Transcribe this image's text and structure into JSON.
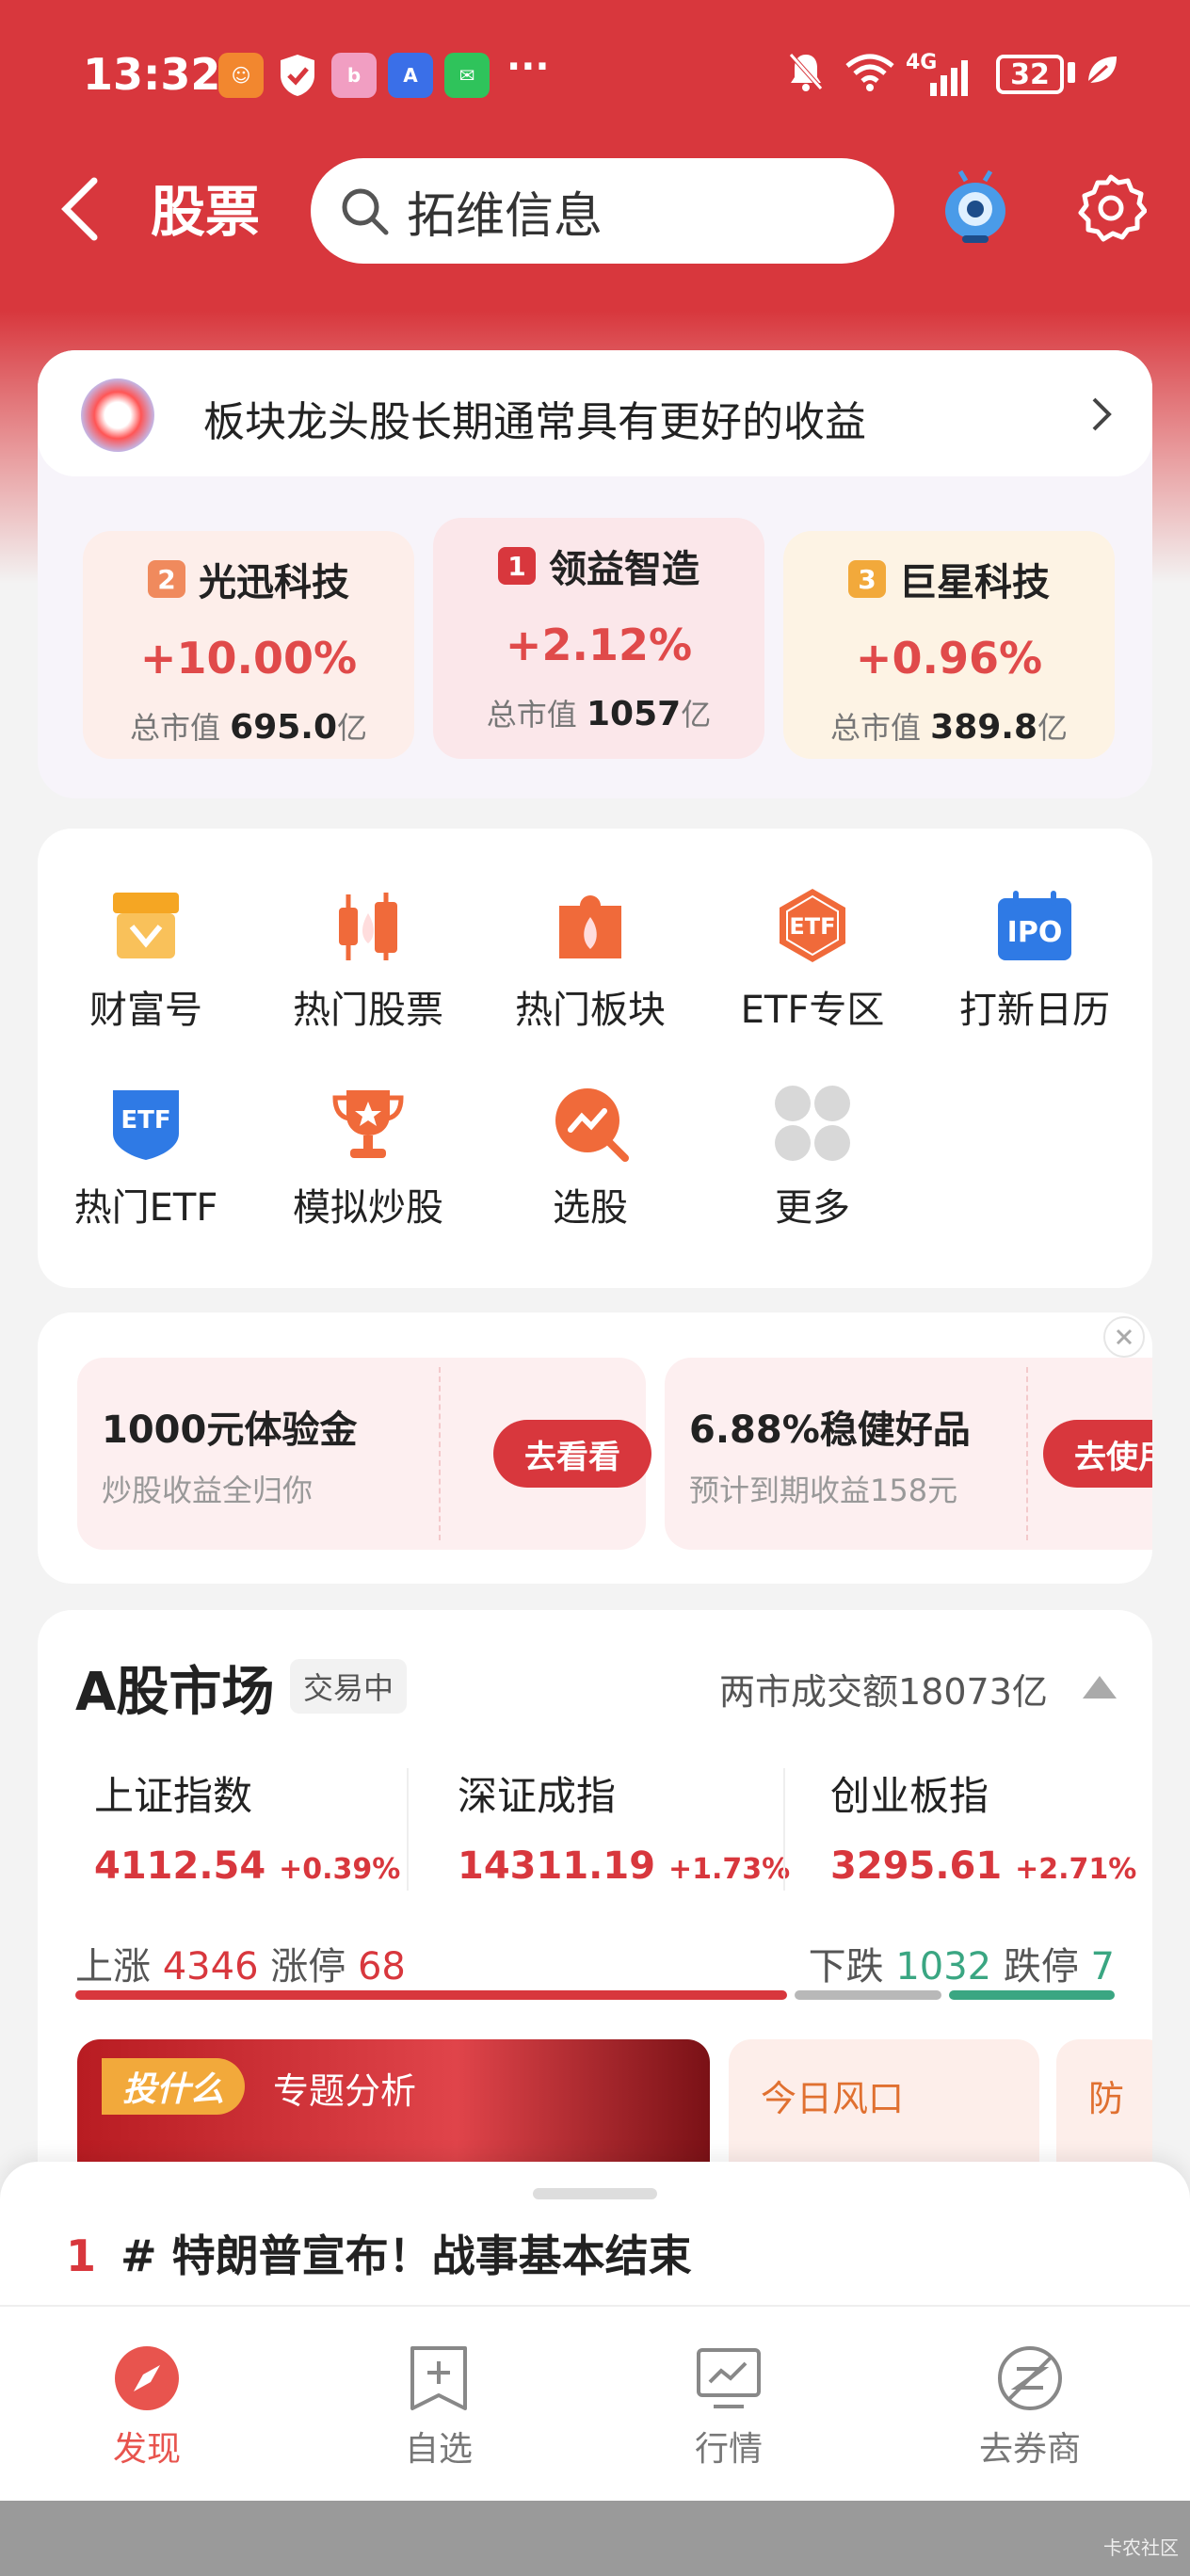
{
  "status_bar": {
    "time": "13:32",
    "more": "···",
    "network": "4G",
    "battery": "32"
  },
  "header": {
    "title": "股票",
    "search_placeholder": "拓维信息"
  },
  "banner": {
    "headline": "板块龙头股长期通常具有更好的收益",
    "stocks": [
      {
        "rank": "2",
        "name": "光迅科技",
        "change": "+10.00%",
        "mcap_label": "总市值",
        "mcap_value": "695.0",
        "mcap_unit": "亿"
      },
      {
        "rank": "1",
        "name": "领益智造",
        "change": "+2.12%",
        "mcap_label": "总市值",
        "mcap_value": "1057",
        "mcap_unit": "亿"
      },
      {
        "rank": "3",
        "name": "巨星科技",
        "change": "+0.96%",
        "mcap_label": "总市值",
        "mcap_value": "389.8",
        "mcap_unit": "亿"
      }
    ]
  },
  "shortcuts": [
    {
      "label": "财富号",
      "icon": "store-icon"
    },
    {
      "label": "热门股票",
      "icon": "candlestick-fire-icon"
    },
    {
      "label": "热门板块",
      "icon": "puzzle-fire-icon"
    },
    {
      "label": "ETF专区",
      "icon": "etf-badge-icon",
      "icon_text": "ETF"
    },
    {
      "label": "打新日历",
      "icon": "ipo-calendar-icon",
      "icon_text": "IPO"
    },
    {
      "label": "热门ETF",
      "icon": "etf-shield-icon",
      "icon_text": "ETF"
    },
    {
      "label": "模拟炒股",
      "icon": "trophy-icon"
    },
    {
      "label": "选股",
      "icon": "stock-picker-icon"
    },
    {
      "label": "更多",
      "icon": "more-grid-icon"
    }
  ],
  "promos": [
    {
      "title": "1000元体验金",
      "subtitle": "炒股收益全归你",
      "button": "去看看"
    },
    {
      "title": "6.88%稳健好品",
      "subtitle": "预计到期收益158元",
      "button": "去使用"
    }
  ],
  "market": {
    "title": "A股市场",
    "status": "交易中",
    "turnover": "两市成交额18073亿",
    "indices": [
      {
        "name": "上证指数",
        "value": "4112.54",
        "change": "+0.39%"
      },
      {
        "name": "深证成指",
        "value": "14311.19",
        "change": "+1.73%"
      },
      {
        "name": "创业板指",
        "value": "3295.61",
        "change": "+2.71%"
      }
    ],
    "up_label": "上涨",
    "up_count": "4346",
    "limit_up_label": "涨停",
    "limit_up_count": "68",
    "down_label": "下跌",
    "down_count": "1032",
    "limit_down_label": "跌停",
    "limit_down_count": "7",
    "cards": [
      {
        "tag": "投什么",
        "title": "专题分析"
      },
      {
        "title": "今日风口"
      },
      {
        "title": "防"
      }
    ]
  },
  "news": {
    "rank": "1",
    "text": "# 特朗普宣布！战事基本结束"
  },
  "tabs": [
    {
      "label": "发现",
      "icon": "compass-icon",
      "active": true
    },
    {
      "label": "自选",
      "icon": "bookmark-add-icon"
    },
    {
      "label": "行情",
      "icon": "chart-monitor-icon"
    },
    {
      "label": "去券商",
      "icon": "broker-icon"
    }
  ],
  "watermark": "卡农社区",
  "colors": {
    "brand_red": "#d8373d",
    "up_red": "#e04a4a",
    "down_green": "#3aa682"
  }
}
